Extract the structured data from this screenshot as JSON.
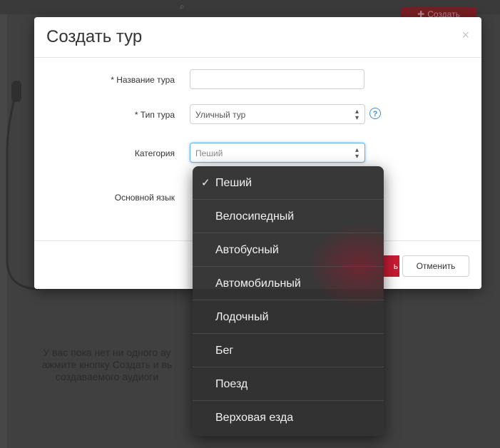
{
  "background": {
    "create_button": "Создать",
    "empty_lines": [
      "У вас пока нет ни одного ау",
      "ажмите кнопку Создать и вь",
      "создаваемого аудиоги"
    ]
  },
  "modal": {
    "title": "Создать тур",
    "close_symbol": "×",
    "fields": {
      "tour_name_label": "* Название тура",
      "tour_name_value": "",
      "tour_type_label": "* Тип тура",
      "tour_type_value": "Уличный тур",
      "category_label": "Категория",
      "category_value": "Пеший",
      "language_label": "Основной язык"
    },
    "help_symbol": "?",
    "footer": {
      "save_partial": "ь",
      "cancel": "Отменить"
    }
  },
  "dropdown": {
    "selected_index": 0,
    "check_symbol": "✓",
    "options": [
      "Пеший",
      "Велосипедный",
      "Автобусный",
      "Автомобильный",
      "Лодочный",
      "Бег",
      "Поезд",
      "Верховая езда"
    ]
  },
  "colors": {
    "accent_red": "#c91b34",
    "focus_blue": "#66afe9",
    "help_blue": "#3a8ee0"
  }
}
